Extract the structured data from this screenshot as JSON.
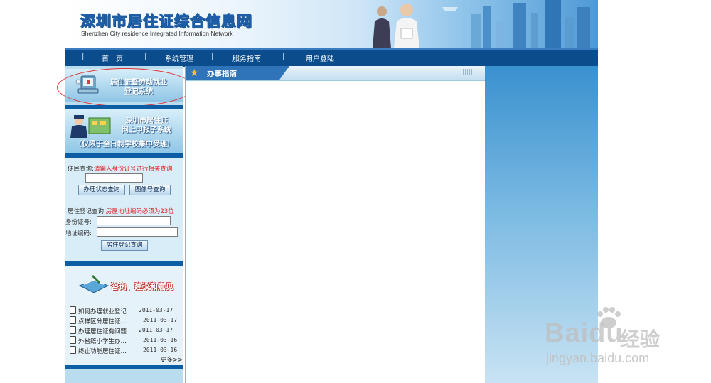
{
  "header": {
    "title": "深圳市居住证综合信息网",
    "subtitle": "Shenzhen City residence Integrated Information Network"
  },
  "nav": {
    "items": [
      {
        "label": "首　页"
      },
      {
        "label": "系统管理"
      },
      {
        "label": "服务指南"
      },
      {
        "label": "用户登陆"
      }
    ],
    "separator": "|"
  },
  "sidebar": {
    "panel1": {
      "line1": "居住证暨劳动就业",
      "line2": "登记系统"
    },
    "panel2": {
      "line1": "深圳市居住证",
      "line2": "网上申报子系统",
      "line3": "（仅限于全日制学校集中受理）"
    },
    "query": {
      "convenience_label": "便民查询:",
      "convenience_hint": "请输入身份证号进行相关查询",
      "btn_status": "办理状态查询",
      "btn_image": "图像号查询",
      "reg_label": "居住登记查询:",
      "reg_hint": "房屋地址编码必须为23位",
      "id_label": "身份证号:",
      "addr_label": "地址编码:",
      "btn_reg": "居住登记查询"
    },
    "feedback": {
      "title": "咨询、建议和意见",
      "items": [
        {
          "title": "如何办理就业登记",
          "date": "2011-03-17"
        },
        {
          "title": "点样区分居住证…",
          "date": "2011-03-17"
        },
        {
          "title": "办理居住证有问题",
          "date": "2011-03-17"
        },
        {
          "title": "外省籍小学生办…",
          "date": "2011-03-16"
        },
        {
          "title": "终止功能居住证…",
          "date": "2011-03-16"
        }
      ],
      "more": "更多>>"
    }
  },
  "main": {
    "title": "办事指南"
  },
  "watermark": {
    "brand": "Bai",
    "brand2": "du",
    "cn": "经验",
    "url": "jingyan.baidu.com"
  },
  "colors": {
    "nav_bg": "#0a4c8c",
    "accent_red": "#e01c1c",
    "sidebar_bg": "#b9dcef"
  }
}
